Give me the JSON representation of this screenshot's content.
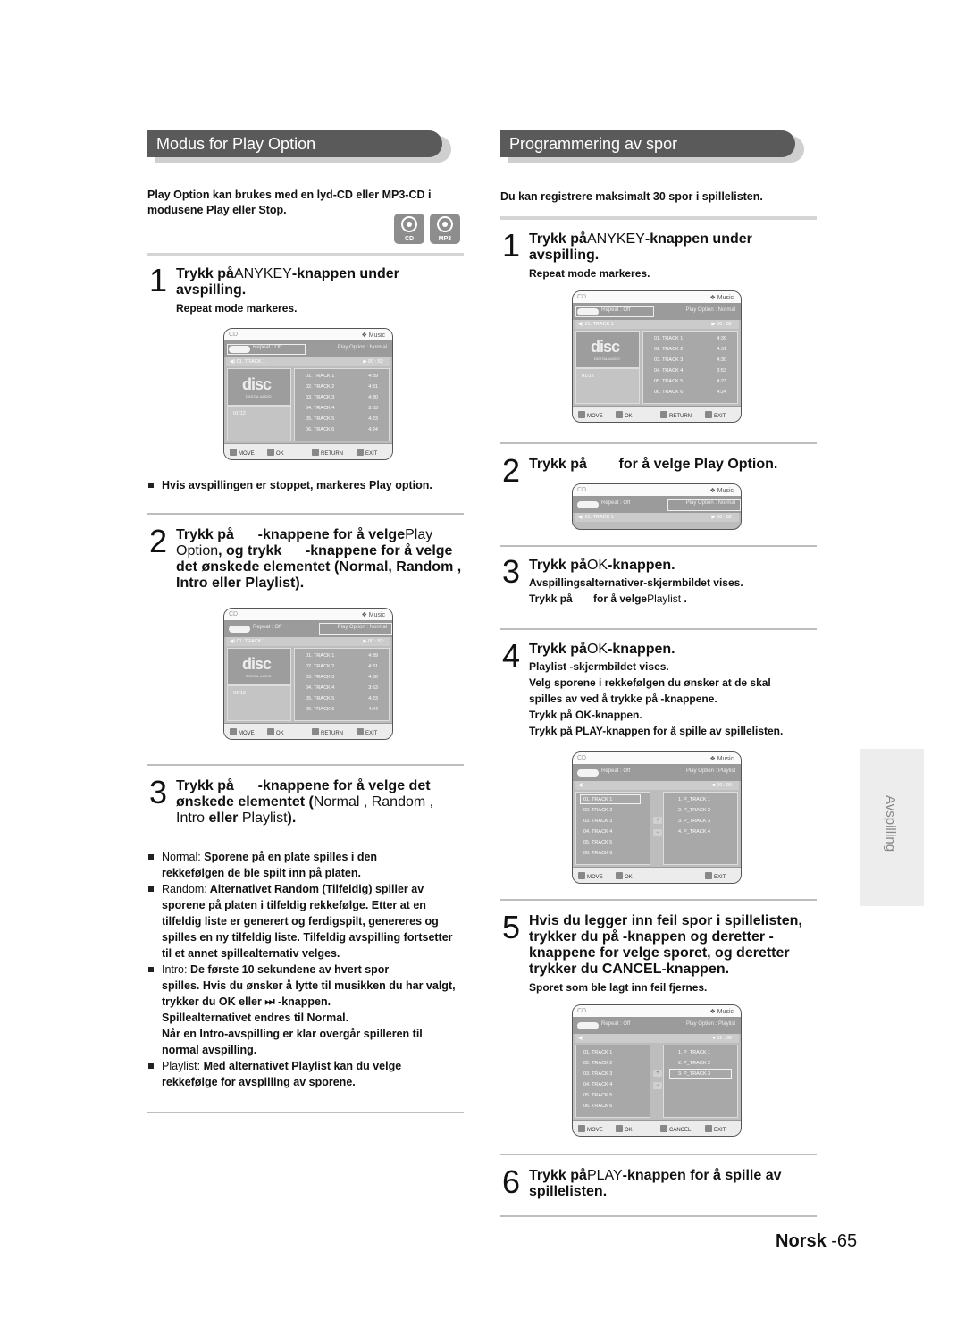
{
  "left": {
    "header": "Modus for Play Option",
    "intro": "Play Option kan brukes med en lyd-CD eller MP3-CD i modusene Play eller Stop.",
    "badges": [
      {
        "icon": "disc-icon",
        "label": "CD"
      },
      {
        "icon": "disc-icon",
        "label": "MP3"
      }
    ],
    "step1": {
      "num": "1",
      "head_a": "Trykk på",
      "head_key": "ANYKEY",
      "head_b": "-knappen under",
      "head_c": "avspilling.",
      "sub": "Repeat mode markeres."
    },
    "note1": "Hvis avspillingen er stoppet, markeres Play option.",
    "step2": {
      "num": "2",
      "line1_a": "Trykk på",
      "line1_b": "-knappene for å velge",
      "line1_key": "Play",
      "line2_key": "Option",
      "line2_b": ", og trykk",
      "line2_c": "-knappene for å velge",
      "line3": "det ønskede elementet (Normal, Random ,",
      "line4": "Intro eller Playlist)."
    },
    "step3": {
      "num": "3",
      "line1_a": "Trykk på",
      "line1_b": "-knappene for å velge det",
      "line2_a": "ønskede elementet (",
      "line2_key": "Normal , Random ,",
      "line3_key1": "Intro",
      "line3_b": "eller",
      "line3_key2": "Playlist",
      "line3_c": ")."
    },
    "options": [
      {
        "term": "Normal:",
        "lines": [
          "Sporene på en plate spilles i den",
          "rekkefølgen de ble spilt inn på platen."
        ]
      },
      {
        "term": "Random:",
        "lines": [
          "Alternativet Random (Tilfeldig) spiller av",
          "sporene på platen i tilfeldig rekkefølge. Etter at en",
          "tilfeldig liste er generert og ferdigspilt, genereres og",
          "spilles en ny tilfeldig liste. Tilfeldig avspilling fortsetter",
          "til et annet spillealternativ velges."
        ]
      },
      {
        "term": "Intro:",
        "lines": [
          "De første 10 sekundene av hvert spor",
          "spilles. Hvis du ønsker å lytte til musikken du har valgt,",
          "trykker du OK eller ⏭ -knappen.",
          "Spillealternativet endres til Normal.",
          "Når en Intro-avspilling er klar overgår spilleren til",
          "normal avspilling."
        ]
      },
      {
        "term": "Playlist:",
        "lines": [
          "Med alternativet Playlist kan du velge",
          "rekkefølge for avspilling av sporene."
        ]
      }
    ]
  },
  "right": {
    "header": "Programmering av spor",
    "intro": "Du kan registrere maksimalt 30 spor i spillelisten.",
    "step1": {
      "num": "1",
      "head_a": "Trykk på",
      "head_key": "ANYKEY",
      "head_b": "-knappen under",
      "head_c": "avspilling.",
      "sub": "Repeat mode markeres."
    },
    "step2": {
      "num": "2",
      "head_a": "Trykk på",
      "head_b": "for å velge Play Option."
    },
    "step3": {
      "num": "3",
      "head_a": "Trykk på",
      "head_key": "OK",
      "head_b": "-knappen.",
      "sub1": "Avspillingsalternativer-skjermbildet vises.",
      "sub2_a": "Trykk på",
      "sub2_b": "for å velge",
      "sub2_key": "Playlist",
      "sub2_c": "."
    },
    "step4": {
      "num": "4",
      "head_a": "Trykk på",
      "head_key": "OK",
      "head_b": "-knappen.",
      "subs": [
        "Playlist -skjermbildet vises.",
        "Velg sporene i rekkefølgen du ønsker at de skal",
        "spilles av ved å trykke på    -knappene.",
        "Trykk på OK-knappen.",
        "Trykk på PLAY-knappen for å spille av spillelisten."
      ]
    },
    "step5": {
      "num": "5",
      "lines": [
        "Hvis du legger inn feil spor i spillelisten,",
        "trykker du på  -knappen og deretter    -",
        "knappene for velge sporet, og deretter",
        "trykker du CANCEL-knappen."
      ],
      "sub": "Sporet som ble lagt inn feil fjernes."
    },
    "step6": {
      "num": "6",
      "head_a": "Trykk på",
      "head_key": "PLAY",
      "head_b": "-knappen for å spille av",
      "head_c": "spillelisten."
    }
  },
  "osd": {
    "cd_label": "CD",
    "music_label": "❖ Music",
    "repeat": "Repeat : Off",
    "play_option_normal": "Play Option : Normal",
    "play_option_playlist": "Play Option : Playlist",
    "now_playing": "01. TRACK 1",
    "time_a": "00 : 52",
    "time_b": "00 : 00",
    "time_c": "01 : 36",
    "disc_logo": "disc",
    "disc_sub": "DIGITAL AUDIO",
    "counter": "01/12",
    "tracks": [
      {
        "name": "01. TRACK 1",
        "dur": "4:39"
      },
      {
        "name": "02. TRACK 2",
        "dur": "4:31"
      },
      {
        "name": "03. TRACK 3",
        "dur": "4:30"
      },
      {
        "name": "04. TRACK 4",
        "dur": "3:53"
      },
      {
        "name": "05. TRACK 5",
        "dur": "4:23"
      },
      {
        "name": "06. TRACK 6",
        "dur": "4:24"
      }
    ],
    "playlist_a": [
      "1. P_TRACK 1",
      "2. P_TRACK 2",
      "3. P_TRACK 3",
      "4. P_TRACK 4"
    ],
    "playlist_b": [
      "1. P_TRACK 1",
      "2. P_TRACK 2",
      "3. P_TRACK 3"
    ],
    "keys": {
      "move": "MOVE",
      "ok": "OK",
      "return": "RETURN",
      "exit": "EXIT",
      "cancel": "CANCEL"
    }
  },
  "side_tab": "Avspilling",
  "footer": {
    "lang": "Norsk",
    "page": "-65"
  }
}
